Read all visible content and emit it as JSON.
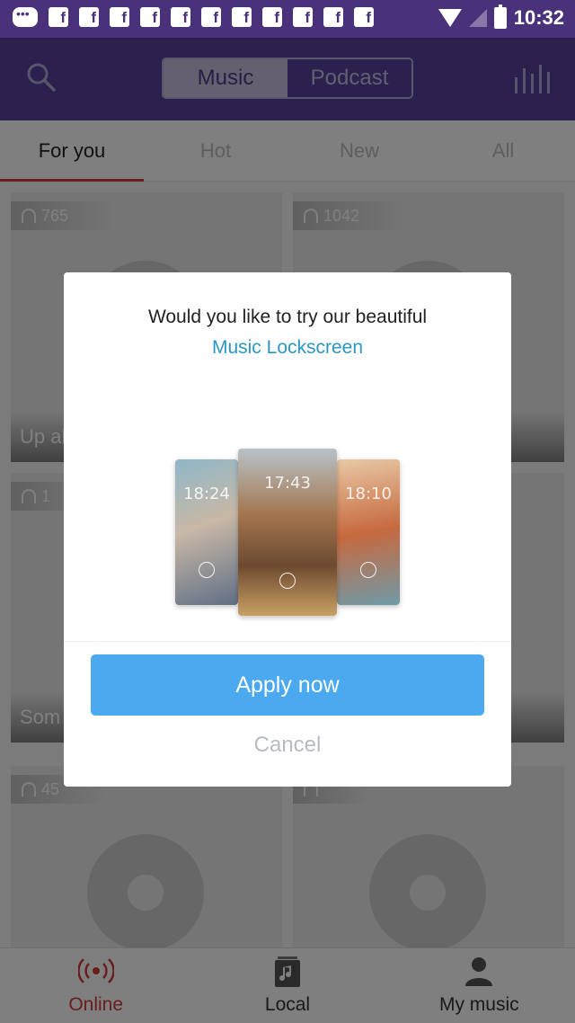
{
  "status_bar": {
    "time": "10:32",
    "notification_letter": "f"
  },
  "header": {
    "segments": [
      "Music",
      "Podcast"
    ],
    "active_segment": "Music"
  },
  "tabs": [
    "For you",
    "Hot",
    "New",
    "All"
  ],
  "active_tab": "For you",
  "cards": [
    {
      "count": "765",
      "caption": "Up al"
    },
    {
      "count": "1042",
      "caption": ""
    },
    {
      "count": "1",
      "caption": "Som"
    },
    {
      "count": "",
      "caption": ""
    },
    {
      "count": "45",
      "caption": ""
    },
    {
      "count": "",
      "caption": ""
    }
  ],
  "bottom_nav": {
    "items": [
      "Online",
      "Local",
      "My music"
    ],
    "active": "Online"
  },
  "dialog": {
    "question": "Would you like to try our beautiful",
    "highlight": "Music Lockscreen",
    "preview_times": [
      "18:24",
      "17:43",
      "18:10"
    ],
    "apply_label": "Apply now",
    "cancel_label": "Cancel"
  },
  "colors": {
    "header_bg": "#59409c",
    "accent_red": "#d23a3a",
    "apply_blue": "#4aa9ef",
    "link_blue": "#2b97c8"
  }
}
